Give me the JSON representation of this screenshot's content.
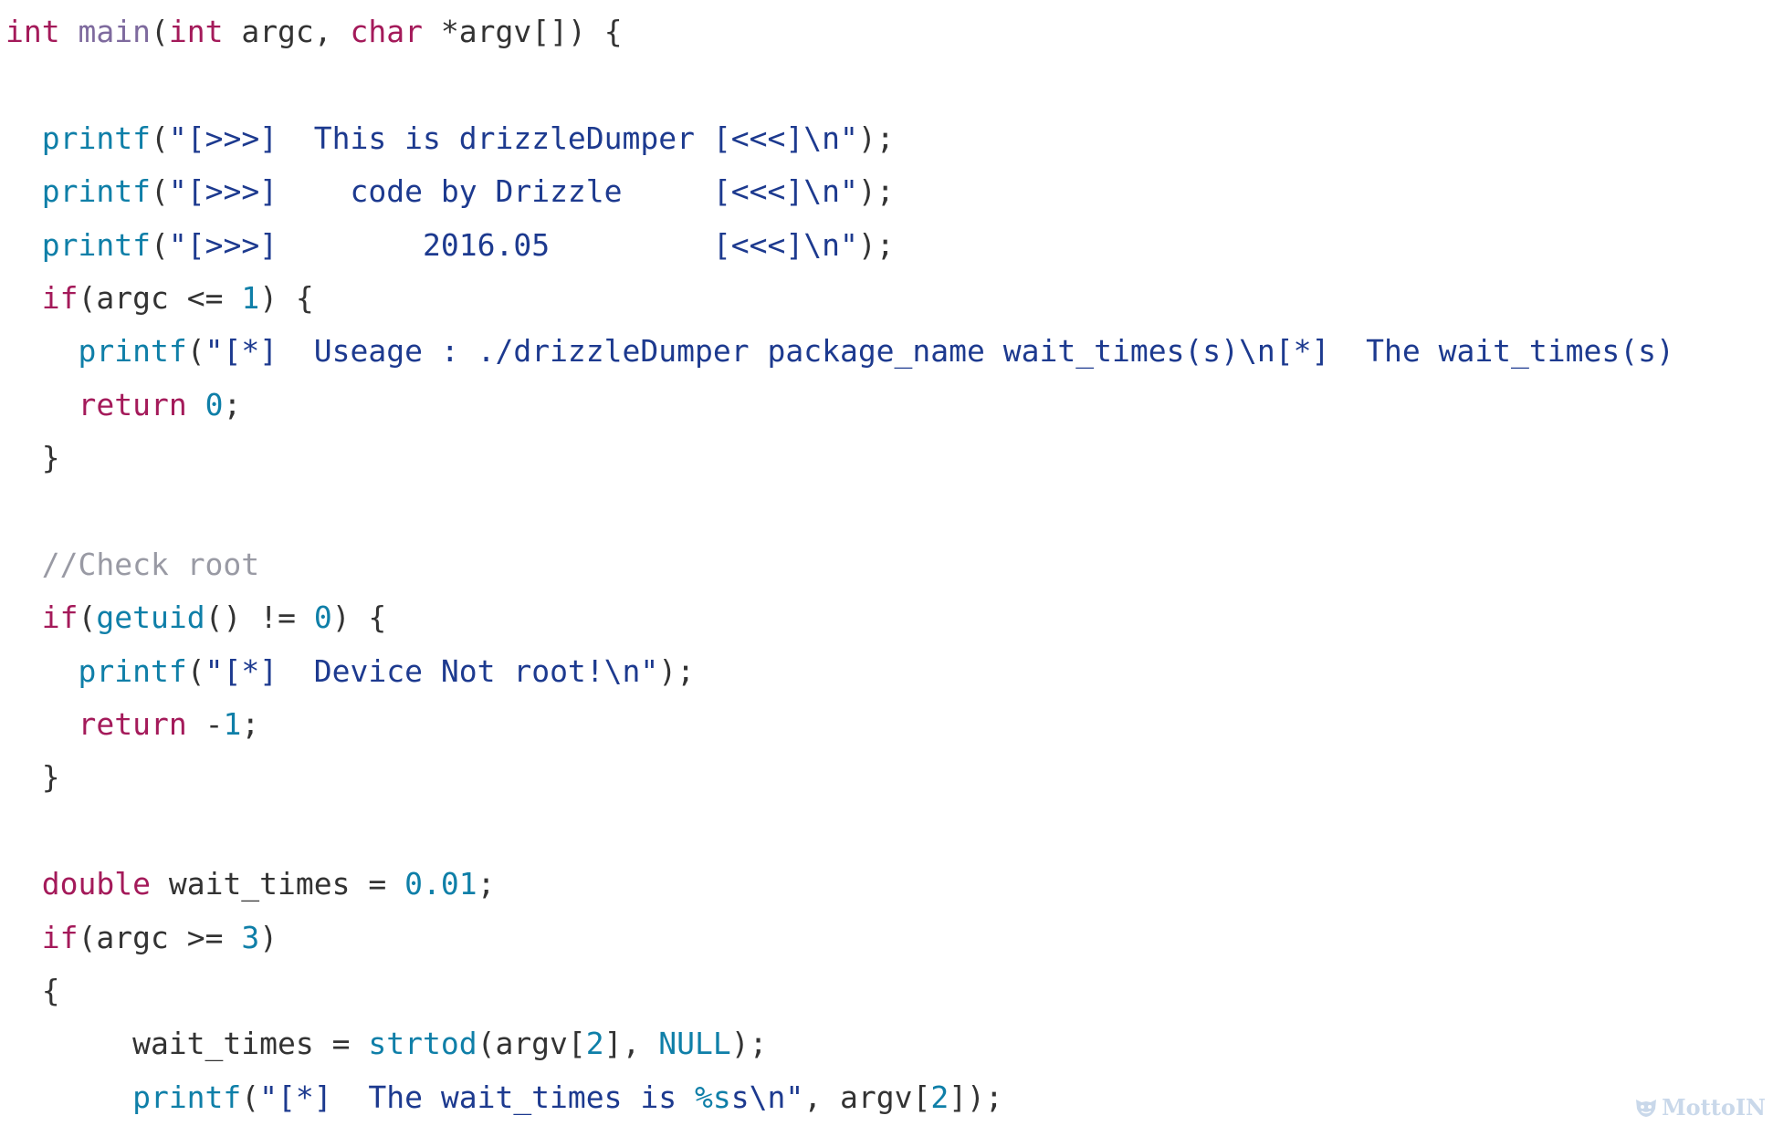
{
  "code": {
    "language": "c",
    "lines": [
      [
        {
          "t": "int",
          "c": "kw"
        },
        {
          "t": " ",
          "c": "pl"
        },
        {
          "t": "main",
          "c": "fndef"
        },
        {
          "t": "(",
          "c": "pl"
        },
        {
          "t": "int",
          "c": "kw"
        },
        {
          "t": " argc, ",
          "c": "pl"
        },
        {
          "t": "char",
          "c": "kw"
        },
        {
          "t": " *argv[]) {",
          "c": "pl"
        }
      ],
      [],
      [
        {
          "t": "  ",
          "c": "pl"
        },
        {
          "t": "printf",
          "c": "fn"
        },
        {
          "t": "(",
          "c": "pl"
        },
        {
          "t": "\"[>>>]  This is drizzleDumper [<<<]\\n\"",
          "c": "str"
        },
        {
          "t": ");",
          "c": "pl"
        }
      ],
      [
        {
          "t": "  ",
          "c": "pl"
        },
        {
          "t": "printf",
          "c": "fn"
        },
        {
          "t": "(",
          "c": "pl"
        },
        {
          "t": "\"[>>>]    code by Drizzle     [<<<]\\n\"",
          "c": "str"
        },
        {
          "t": ");",
          "c": "pl"
        }
      ],
      [
        {
          "t": "  ",
          "c": "pl"
        },
        {
          "t": "printf",
          "c": "fn"
        },
        {
          "t": "(",
          "c": "pl"
        },
        {
          "t": "\"[>>>]        2016.05         [<<<]\\n\"",
          "c": "str"
        },
        {
          "t": ");",
          "c": "pl"
        }
      ],
      [
        {
          "t": "  ",
          "c": "pl"
        },
        {
          "t": "if",
          "c": "kw"
        },
        {
          "t": "(argc <= ",
          "c": "pl"
        },
        {
          "t": "1",
          "c": "num"
        },
        {
          "t": ") {",
          "c": "pl"
        }
      ],
      [
        {
          "t": "    ",
          "c": "pl"
        },
        {
          "t": "printf",
          "c": "fn"
        },
        {
          "t": "(",
          "c": "pl"
        },
        {
          "t": "\"[*]  Useage : ./drizzleDumper package_name wait_times(s)\\n[*]  The wait_times(s)",
          "c": "str"
        }
      ],
      [
        {
          "t": "    ",
          "c": "pl"
        },
        {
          "t": "return",
          "c": "kw"
        },
        {
          "t": " ",
          "c": "pl"
        },
        {
          "t": "0",
          "c": "num"
        },
        {
          "t": ";",
          "c": "pl"
        }
      ],
      [
        {
          "t": "  }",
          "c": "pl"
        }
      ],
      [],
      [
        {
          "t": "  ",
          "c": "pl"
        },
        {
          "t": "//Check root",
          "c": "cm"
        }
      ],
      [
        {
          "t": "  ",
          "c": "pl"
        },
        {
          "t": "if",
          "c": "kw"
        },
        {
          "t": "(",
          "c": "pl"
        },
        {
          "t": "getuid",
          "c": "fn"
        },
        {
          "t": "() != ",
          "c": "pl"
        },
        {
          "t": "0",
          "c": "num"
        },
        {
          "t": ") {",
          "c": "pl"
        }
      ],
      [
        {
          "t": "    ",
          "c": "pl"
        },
        {
          "t": "printf",
          "c": "fn"
        },
        {
          "t": "(",
          "c": "pl"
        },
        {
          "t": "\"[*]  Device Not root!\\n\"",
          "c": "str"
        },
        {
          "t": ");",
          "c": "pl"
        }
      ],
      [
        {
          "t": "    ",
          "c": "pl"
        },
        {
          "t": "return",
          "c": "kw"
        },
        {
          "t": " -",
          "c": "pl"
        },
        {
          "t": "1",
          "c": "num"
        },
        {
          "t": ";",
          "c": "pl"
        }
      ],
      [
        {
          "t": "  }",
          "c": "pl"
        }
      ],
      [],
      [
        {
          "t": "  ",
          "c": "pl"
        },
        {
          "t": "double",
          "c": "kw"
        },
        {
          "t": " wait_times = ",
          "c": "pl"
        },
        {
          "t": "0.01",
          "c": "num"
        },
        {
          "t": ";",
          "c": "pl"
        }
      ],
      [
        {
          "t": "  ",
          "c": "pl"
        },
        {
          "t": "if",
          "c": "kw"
        },
        {
          "t": "(argc >= ",
          "c": "pl"
        },
        {
          "t": "3",
          "c": "num"
        },
        {
          "t": ")",
          "c": "pl"
        }
      ],
      [
        {
          "t": "  {",
          "c": "pl"
        }
      ],
      [
        {
          "t": "       wait_times = ",
          "c": "pl"
        },
        {
          "t": "strtod",
          "c": "fn"
        },
        {
          "t": "(argv[",
          "c": "pl"
        },
        {
          "t": "2",
          "c": "num"
        },
        {
          "t": "], ",
          "c": "pl"
        },
        {
          "t": "NULL",
          "c": "fn"
        },
        {
          "t": ");",
          "c": "pl"
        }
      ],
      [
        {
          "t": "       ",
          "c": "pl"
        },
        {
          "t": "printf",
          "c": "fn"
        },
        {
          "t": "(",
          "c": "pl"
        },
        {
          "t": "\"[*]  The wait_times is ",
          "c": "str"
        },
        {
          "t": "%s",
          "c": "fn"
        },
        {
          "t": "s\\n\"",
          "c": "str"
        },
        {
          "t": ", argv[",
          "c": "pl"
        },
        {
          "t": "2",
          "c": "num"
        },
        {
          "t": "]);",
          "c": "pl"
        }
      ]
    ]
  },
  "colors": {
    "keyword": "#a41a5a",
    "function": "#0f7fa8",
    "function_definition": "#7e6a9e",
    "string": "#1d3a8f",
    "number": "#0f7fa8",
    "comment": "#999aa4",
    "plain": "#333333"
  },
  "watermark": {
    "text": "MottoIN",
    "icon": "mask-icon"
  }
}
